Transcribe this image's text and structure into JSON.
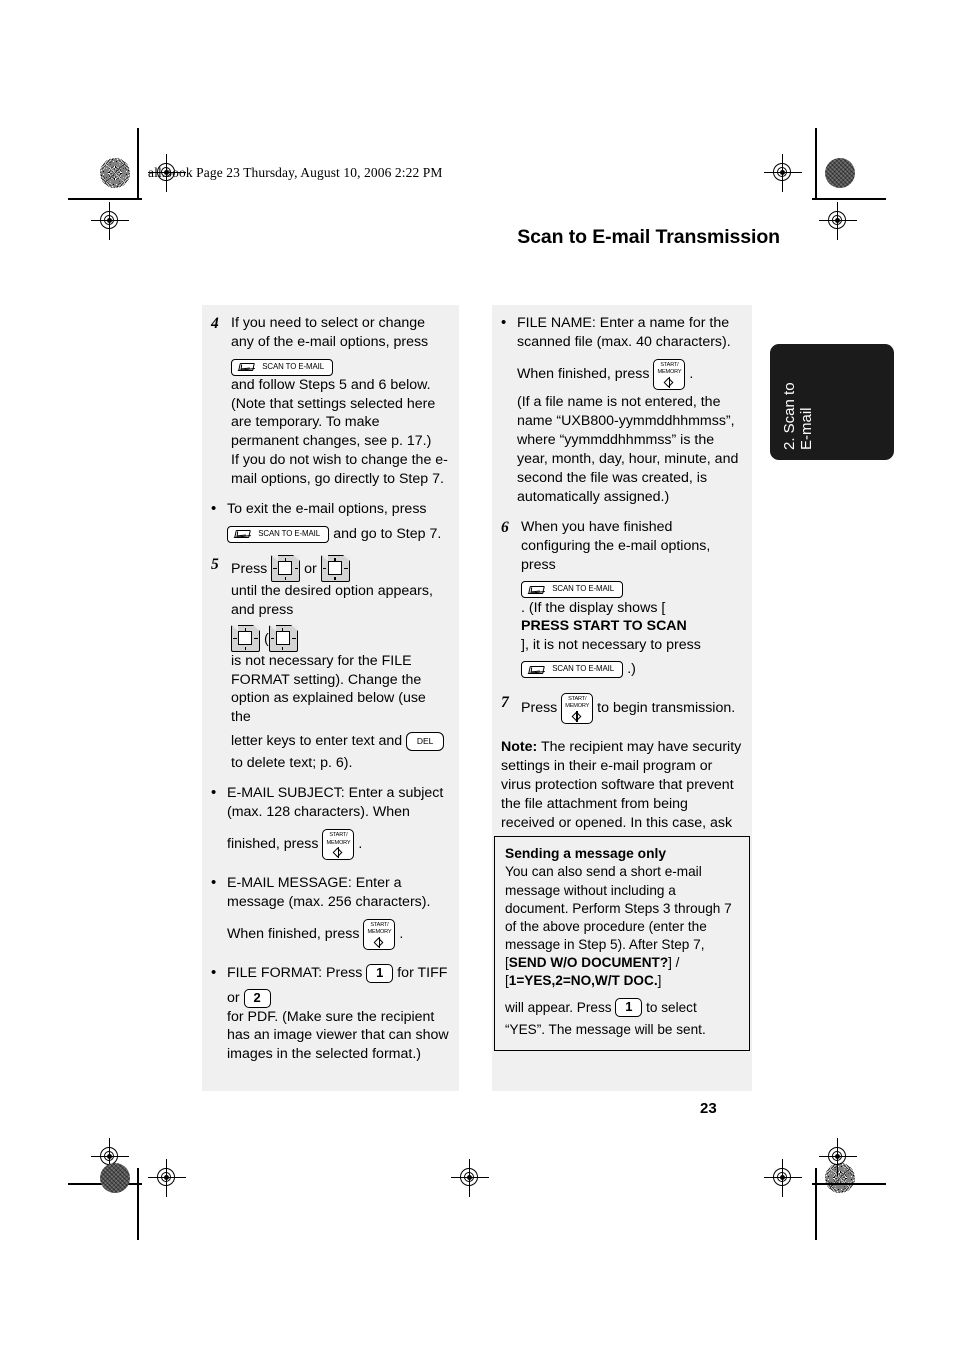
{
  "header": {
    "file_line": "all.book  Page 23  Thursday, August 10, 2006  2:22 PM"
  },
  "page_title": "Scan to E-mail Transmission",
  "side_tab": {
    "label": "2. Scan to\nE-mail"
  },
  "page_number": "23",
  "keys": {
    "scan_to_email": "SCAN TO E-MAIL",
    "start_memory_line1": "START/",
    "start_memory_line2": "MEMORY",
    "del": "DEL",
    "num_1": "1",
    "num_2": "2"
  },
  "left_column": {
    "step4": {
      "number": "4",
      "text_a": "If you need to select or change any of the e-mail options, press",
      "text_b": "and follow Steps 5 and 6 below. (Note that settings selected here are temporary. To make permanent changes, see p. 17.)",
      "text_c": "If you do not wish to change the e-mail options, go directly to Step 7."
    },
    "bullet_exit": {
      "text_a": "To exit the e-mail options, press",
      "text_b": "and go to Step 7."
    },
    "step5": {
      "number": "5",
      "text_press": "Press",
      "text_or": "or",
      "text_until": "until the desired option appears, and press",
      "text_paren_open": "(",
      "text_b": "is not necessary for the FILE FORMAT setting). Change the option as explained below (use the",
      "text_c": "letter keys to enter text and",
      "text_d": "to delete text; p. 6)."
    },
    "bullet_subject": {
      "text_a": "E-MAIL SUBJECT: Enter a subject (max. 128 characters). When",
      "text_b": "finished, press",
      "text_c": "."
    },
    "bullet_message": {
      "text_a": "E-MAIL MESSAGE: Enter a message (max. 256 characters).",
      "text_b": "When finished, press",
      "text_c": "."
    },
    "bullet_format": {
      "text_a": "FILE FORMAT: Press",
      "text_b": "for TIFF",
      "text_c": "or",
      "text_d": "for PDF. (Make sure the recipient has an image viewer  that can show images in the selected format.)"
    }
  },
  "right_column": {
    "bullet_filename": {
      "text_a": "FILE NAME: Enter a name for the scanned file (max. 40 characters).",
      "text_b": "When finished, press",
      "text_c": ".",
      "text_d": "(If a file name is not entered, the name “UXB800-yymmddhhmmss”, where “yymmddhhmmss” is the year, month, day, hour, minute, and second the file was created, is automatically assigned.)"
    },
    "step6": {
      "number": "6",
      "text_a": "When you have finished configuring the e-mail options, press",
      "text_b": ". (If the display shows [",
      "display_bold": "PRESS START TO SCAN",
      "text_c": "], it is not necessary to press",
      "text_d": ".)"
    },
    "step7": {
      "number": "7",
      "text_press": "Press",
      "text_after": "to begin transmission."
    },
    "note": {
      "label": "Note:",
      "text": " The recipient may have security settings in their e-mail program or virus protection software that prevent the file attachment from being received or opened. In this case, ask the recipient to try changing the settings."
    }
  },
  "callout": {
    "title": "Sending a message only",
    "text_a": "You can also send a short e-mail message without including a document. Perform Steps 3 through 7 of the above procedure (enter the message in Step 5). After Step 7,",
    "bracket_open_1": "[",
    "bold_1": "SEND W/O DOCUMENT?",
    "bracket_close_1": "] / ",
    "bracket_open_2": "[",
    "bold_2": "1=YES,2=NO,W/T DOC.",
    "bracket_close_2": "]",
    "text_b": "will appear. Press",
    "text_c": "to select",
    "text_d": "“YES”. The message will be sent."
  }
}
